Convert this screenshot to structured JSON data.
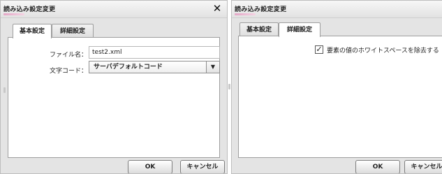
{
  "left_dialog": {
    "title": "読み込み設定変更",
    "close_glyph": "✕",
    "tabs": [
      {
        "label": "基本設定",
        "active": true
      },
      {
        "label": "詳細設定",
        "active": false
      }
    ],
    "filename_label": "ファイル名：",
    "filename_value": "test2.xml",
    "encoding_label": "文字コード：",
    "encoding_value": "サーバデフォルトコード",
    "dropdown_arrow": "▼",
    "ok_label": "OK",
    "cancel_label": "キャンセル"
  },
  "right_dialog": {
    "title": "読み込み設定変更",
    "tabs": [
      {
        "label": "基本設定",
        "active": false
      },
      {
        "label": "詳細設定",
        "active": true
      }
    ],
    "whitespace_checkbox_checked": true,
    "check_glyph": "✓",
    "whitespace_label": "要素の値のホワイトスペースを除去する",
    "ok_label": "OK",
    "cancel_label": "キャンセル"
  },
  "icons": [
    "close-icon",
    "dropdown-arrow-icon",
    "checkmark-icon"
  ],
  "colors": {
    "dialog_bg": "#e4e4e4",
    "panel_bg": "#ffffff",
    "title_accent": "#e4a6c6"
  }
}
